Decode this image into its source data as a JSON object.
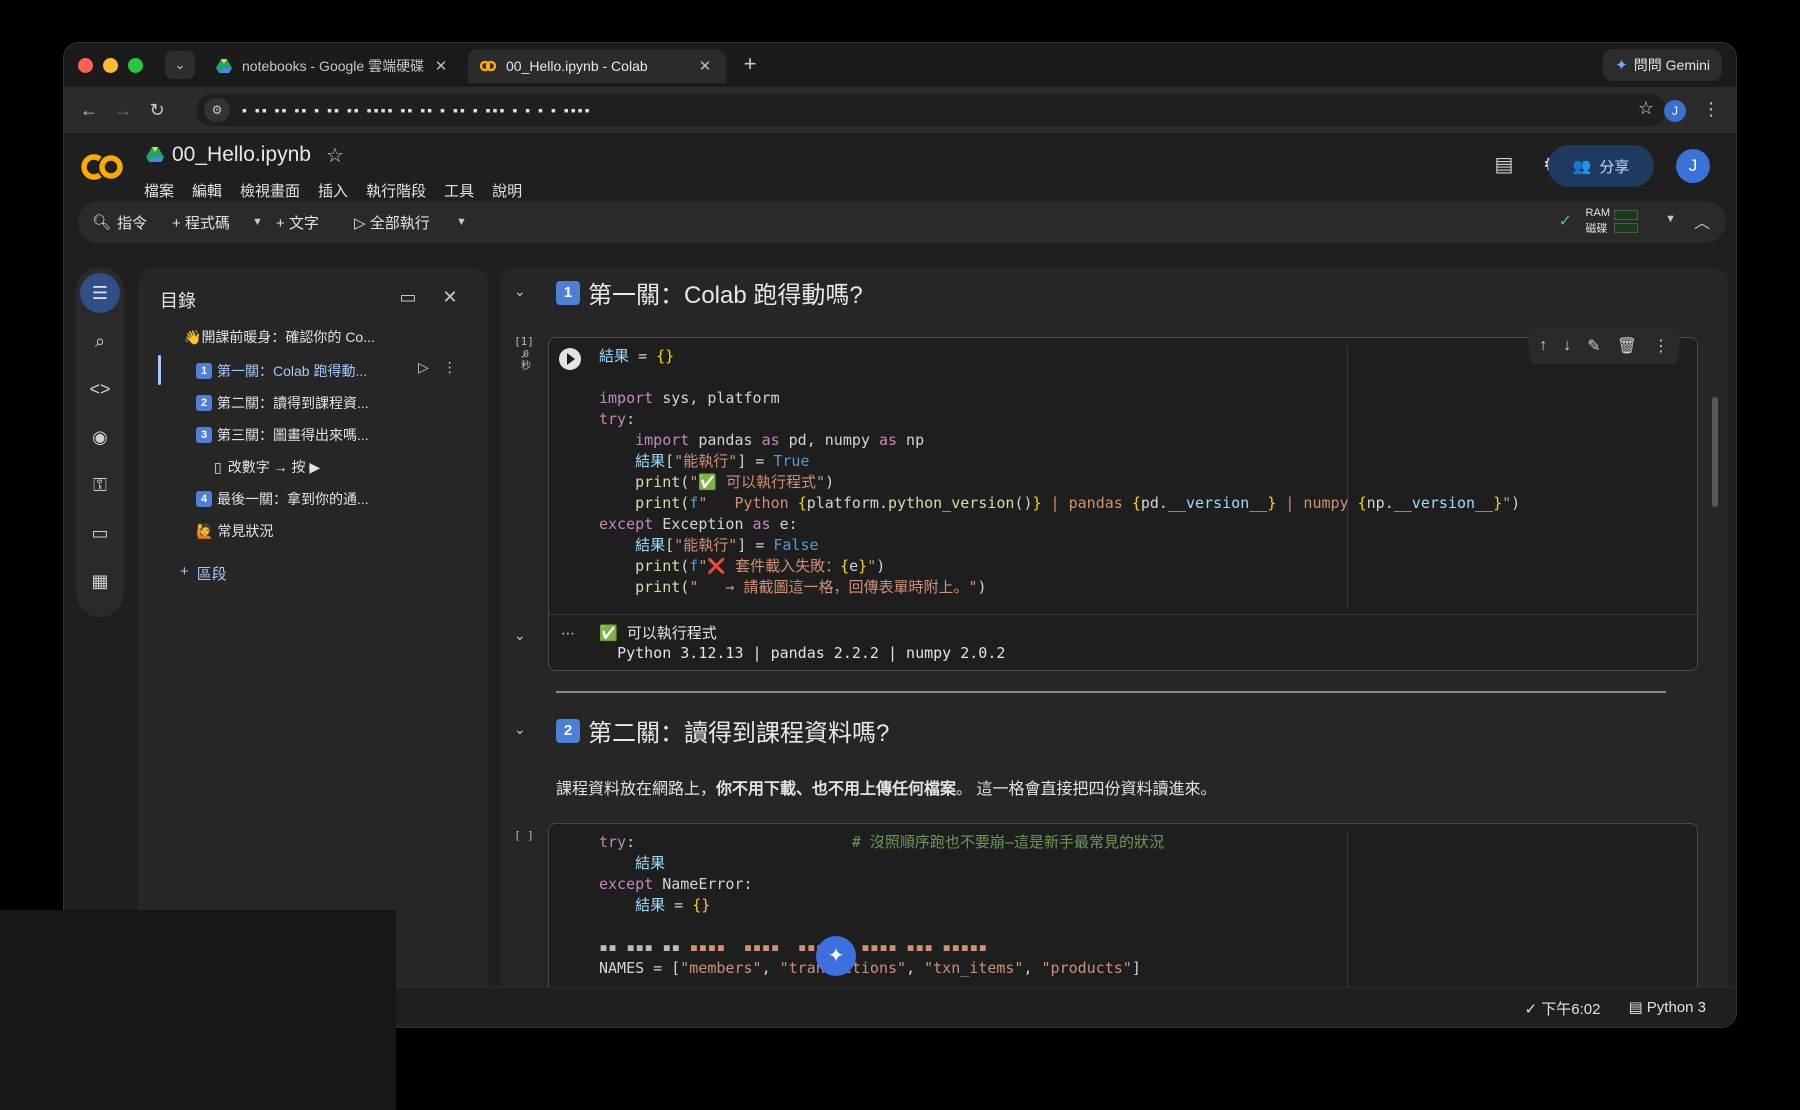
{
  "browser": {
    "tabs": [
      {
        "title": "notebooks - Google 雲端硬碟",
        "close": "✕"
      },
      {
        "title": "00_Hello.ipynb - Colab",
        "close": "✕"
      }
    ],
    "new_tab": "+",
    "gemini_label": "問問 Gemini",
    "url_masked": "▪ ▪▪ ▪▪ ▪▪ ▪ ▪▪ ▪▪ ▪▪▪▪   ▪▪ ▪▪ ▪   ▪▪ ▪ ▪▪▪ ▪ ▪ ▪  ▪ ▪▪▪▪",
    "profile_initial": "J"
  },
  "colab": {
    "notebook_title": "00_Hello.ipynb",
    "menu": [
      "檔案",
      "編輯",
      "檢視畫面",
      "插入",
      "執行階段",
      "工具",
      "說明"
    ],
    "share_label": "分享",
    "user_initial": "J",
    "toolbar": {
      "command": "指令",
      "code": "+ 程式碼",
      "text": "+ 文字",
      "run_all": "▷ 全部執行",
      "ram": "RAM",
      "disk": "磁碟"
    }
  },
  "toc": {
    "title": "目錄",
    "items": [
      {
        "emoji": "👋",
        "label": "開課前暖身：確認你的 Co..."
      },
      {
        "badge": "1",
        "label": "第一關：Colab 跑得動..."
      },
      {
        "badge": "2",
        "label": "第二關：讀得到課程資..."
      },
      {
        "badge": "3",
        "label": "第三關：圖畫得出來嗎..."
      },
      {
        "emoji": "▯",
        "label": "改數字 → 按 ▶"
      },
      {
        "badge": "4",
        "label": "最後一關：拿到你的通..."
      },
      {
        "emoji": "🙋",
        "label": "常見狀況"
      }
    ],
    "add_section": "區段"
  },
  "notebook": {
    "section1": {
      "badge": "1",
      "title": "第一關：Colab 跑得動嗎?"
    },
    "cell1": {
      "exec_count": "[1]",
      "exec_time": "0\n秒",
      "output_line1": "可以執行程式",
      "output_line2": "Python 3.12.13 | pandas 2.2.2 | numpy 2.0.2"
    },
    "section2": {
      "badge": "2",
      "title": "第二關：讀得到課程資料嗎?",
      "para_prefix": "課程資料放在網路上，",
      "para_bold": "你不用下載、也不用上傳任何檔案",
      "para_suffix": "。 這一格會直接把四份資料讀進來。"
    },
    "cell2": {
      "exec_count": "[ ]"
    }
  },
  "status": {
    "time": "下午6:02",
    "runtime": "Python 3"
  },
  "colors": {
    "accent": "#a8c7fa",
    "share_bg": "#1f3a5f",
    "badge": "#4d7fd6"
  }
}
